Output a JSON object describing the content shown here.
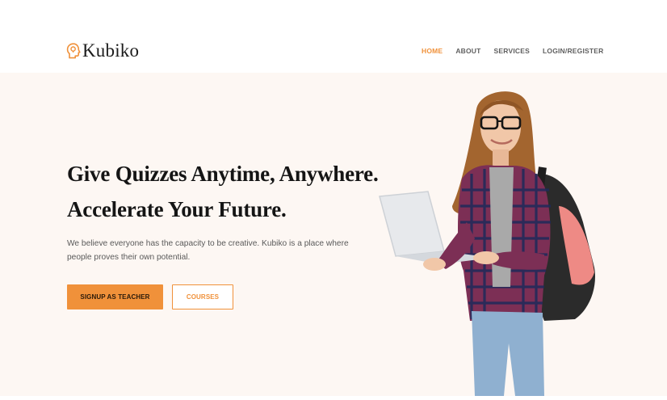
{
  "header": {
    "logo_text": "Kubiko",
    "logo_icon": "head-idea-icon",
    "nav": [
      {
        "label": "HOME",
        "active": true
      },
      {
        "label": "ABOUT",
        "active": false
      },
      {
        "label": "SERVICES",
        "active": false
      },
      {
        "label": "LOGIN/REGISTER",
        "active": false
      }
    ]
  },
  "hero": {
    "title_line1": "Give Quizzes Anytime, Anywhere.",
    "title_line2": "Accelerate Your Future.",
    "description": "We believe everyone has the capacity to be creative. Kubiko is a place where people proves their own potential.",
    "primary_button": "SIGNUP AS TEACHER",
    "secondary_button": "COURSES",
    "image": "student-with-laptop-photo"
  },
  "colors": {
    "accent": "#f0913a",
    "hero_background": "#fdf7f3",
    "heading": "#151515",
    "body_text": "#5a5a5a",
    "nav_text": "#5f5f5f"
  }
}
